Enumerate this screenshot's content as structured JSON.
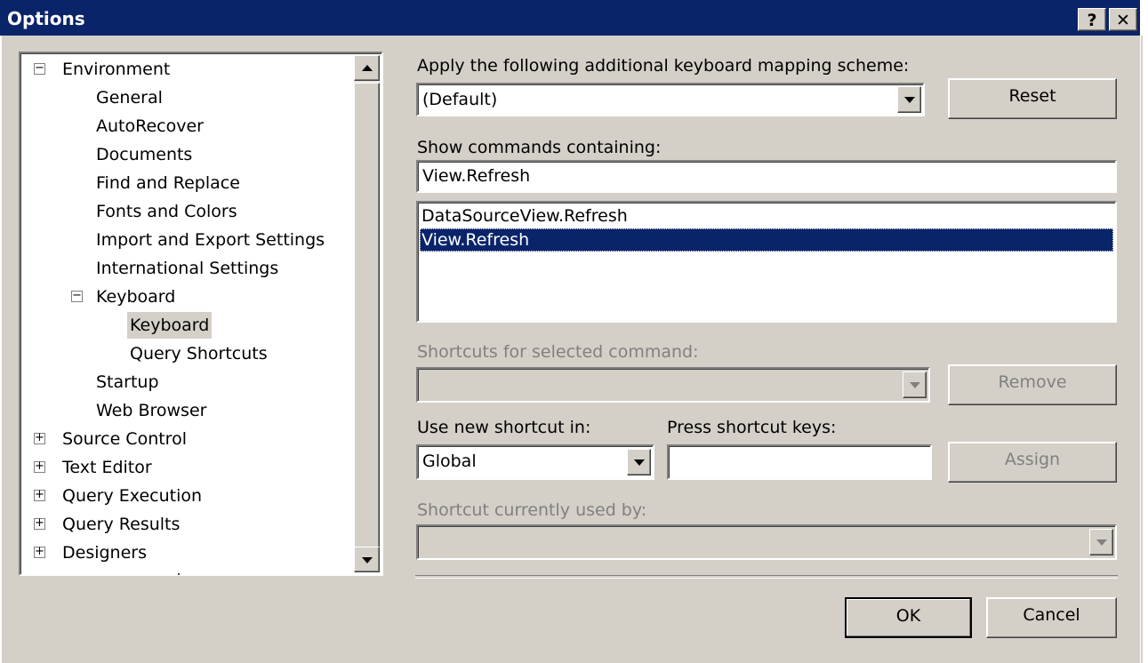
{
  "window": {
    "title": "Options",
    "help_glyph": "?",
    "close_glyph": "✕"
  },
  "tree": {
    "items": [
      {
        "label": "Environment",
        "expander": "−"
      },
      {
        "label": "General"
      },
      {
        "label": "AutoRecover"
      },
      {
        "label": "Documents"
      },
      {
        "label": "Find and Replace"
      },
      {
        "label": "Fonts and Colors"
      },
      {
        "label": "Import and Export Settings"
      },
      {
        "label": "International Settings"
      },
      {
        "label": "Keyboard",
        "expander": "−"
      },
      {
        "label": "Keyboard",
        "selected": true
      },
      {
        "label": "Query Shortcuts"
      },
      {
        "label": "Startup"
      },
      {
        "label": "Web Browser"
      },
      {
        "label": "Source Control",
        "expander": "+"
      },
      {
        "label": "Text Editor",
        "expander": "+"
      },
      {
        "label": "Query Execution",
        "expander": "+"
      },
      {
        "label": "Query Results",
        "expander": "+"
      },
      {
        "label": "Designers",
        "expander": "+"
      }
    ]
  },
  "mapping": {
    "label": "Apply the following additional keyboard mapping scheme:",
    "value": "(Default)",
    "reset_label": "Reset"
  },
  "commands": {
    "label": "Show commands containing:",
    "filter_value": "View.Refresh",
    "items": [
      "DataSourceView.Refresh",
      "View.Refresh"
    ],
    "selected_index": 1
  },
  "shortcuts": {
    "label": "Shortcuts for selected command:",
    "value": "",
    "remove_label": "Remove"
  },
  "new_shortcut": {
    "use_in_label": "Use new shortcut in:",
    "use_in_value": "Global",
    "press_keys_label": "Press shortcut keys:",
    "press_keys_value": "",
    "assign_label": "Assign"
  },
  "used_by": {
    "label": "Shortcut currently used by:",
    "value": ""
  },
  "footer": {
    "ok_label": "OK",
    "cancel_label": "Cancel"
  },
  "colors": {
    "title_bar": "#0a246a",
    "face": "#d4d0c8",
    "selection": "#0a246a",
    "disabled_text": "#808080"
  }
}
